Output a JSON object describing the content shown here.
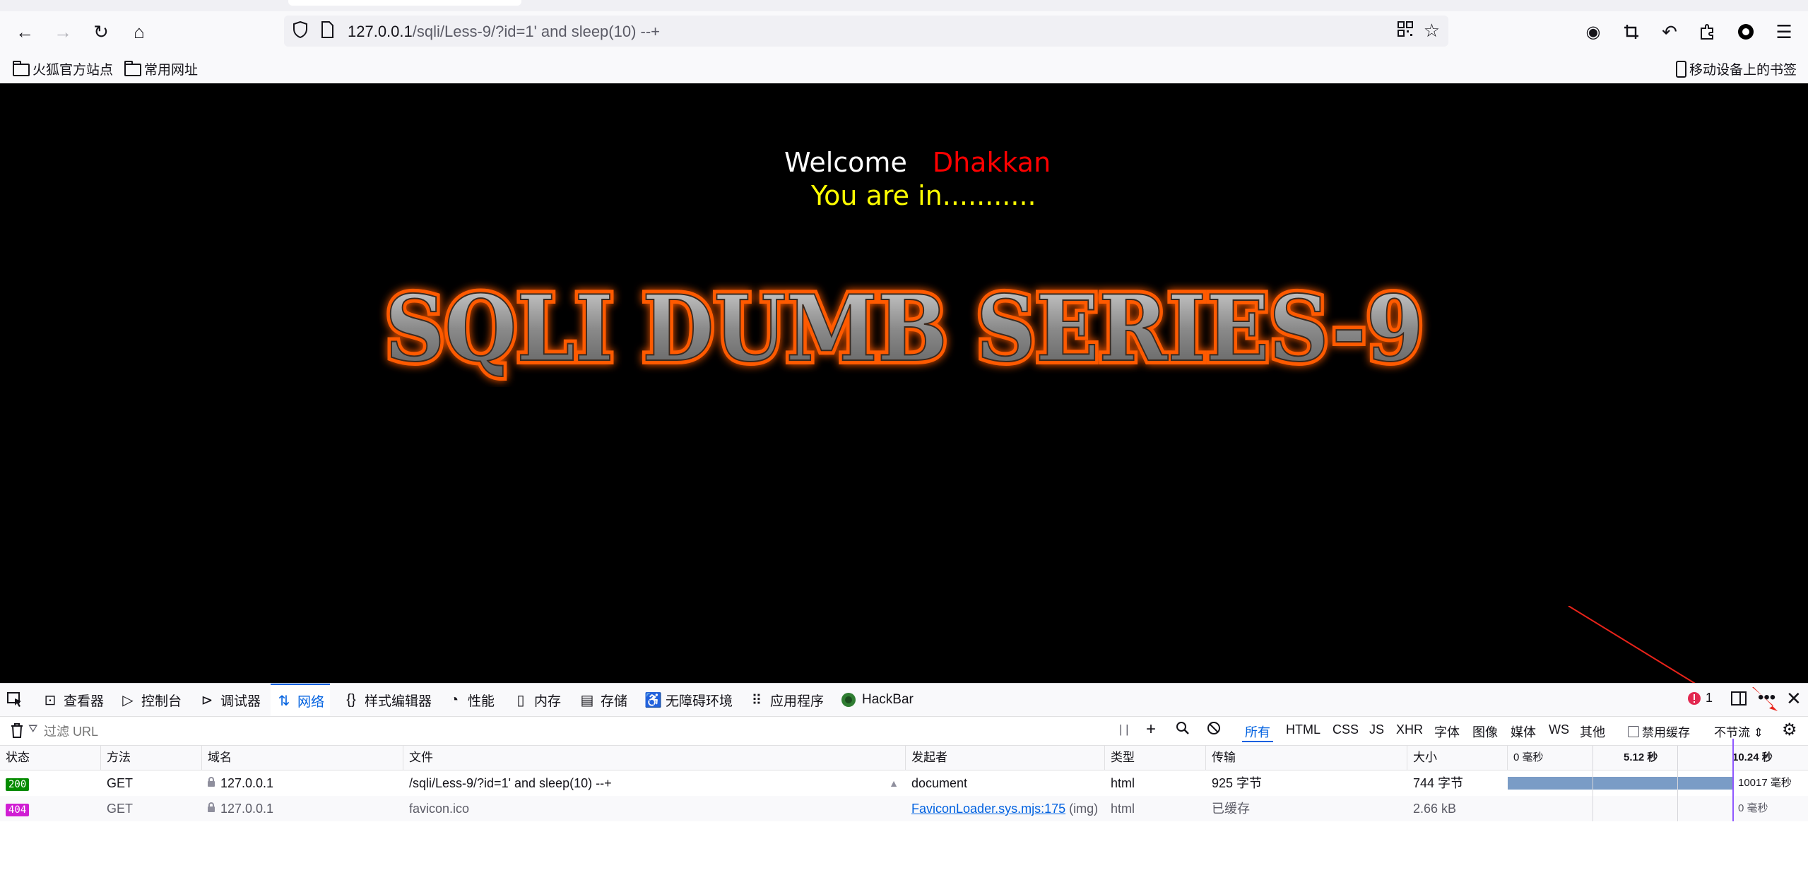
{
  "browser": {
    "url_host": "127.0.0.1",
    "url_path": "/sqli/Less-9/?id=1' and sleep(10) --+",
    "bookmarks": [
      {
        "label": "火狐官方站点"
      },
      {
        "label": "常用网址"
      }
    ],
    "mobile_bookmarks_label": "移动设备上的书签"
  },
  "page": {
    "welcome": "Welcome",
    "name": "Dhakkan",
    "status": "You are in...........",
    "banner": "SQLI DUMB SERIES-9"
  },
  "devtools": {
    "tabs": [
      {
        "label": "查看器",
        "icon": "inspector-icon"
      },
      {
        "label": "控制台",
        "icon": "console-icon"
      },
      {
        "label": "调试器",
        "icon": "debugger-icon"
      },
      {
        "label": "网络",
        "icon": "network-icon",
        "active": true
      },
      {
        "label": "样式编辑器",
        "icon": "style-editor-icon"
      },
      {
        "label": "性能",
        "icon": "performance-icon"
      },
      {
        "label": "内存",
        "icon": "memory-icon"
      },
      {
        "label": "存储",
        "icon": "storage-icon"
      },
      {
        "label": "无障碍环境",
        "icon": "accessibility-icon"
      },
      {
        "label": "应用程序",
        "icon": "application-icon"
      },
      {
        "label": "HackBar",
        "icon": "hackbar-icon"
      }
    ],
    "error_count": "1",
    "filter_placeholder": "过滤 URL",
    "pause_label": "| |",
    "filter_types": [
      "所有",
      "HTML",
      "CSS",
      "JS",
      "XHR",
      "字体",
      "图像",
      "媒体",
      "WS",
      "其他"
    ],
    "disable_cache_label": "禁用缓存",
    "throttle_label": "不节流 ⇕",
    "columns": [
      "状态",
      "方法",
      "域名",
      "文件",
      "发起者",
      "类型",
      "传输",
      "大小",
      "0 毫秒",
      "5.12 秒",
      "10.24 秒"
    ],
    "requests": [
      {
        "status": "200",
        "method": "GET",
        "domain": "127.0.0.1",
        "file": "/sqli/Less-9/?id=1' and sleep(10) --+",
        "initiator": "document",
        "initiator_extra": "",
        "type": "html",
        "transferred": "925 字节",
        "size": "744 字节",
        "timing": "10017 毫秒",
        "timing_fraction": 1.0
      },
      {
        "status": "404",
        "method": "GET",
        "domain": "127.0.0.1",
        "file": "favicon.ico",
        "initiator": "FaviconLoader.sys.mjs:175",
        "initiator_extra": " (img)",
        "type": "html",
        "transferred": "已缓存",
        "size": "2.66 kB",
        "timing": "0 毫秒",
        "timing_fraction": 0.0
      }
    ]
  },
  "colors": {
    "accent": "#0061e0",
    "welcome_name": "#ff0000",
    "status_text": "#ffff00",
    "status_200": "#058b00",
    "status_404": "#d01ed3",
    "timing_bar": "#7a9cc6",
    "arrow": "#e8231a"
  }
}
